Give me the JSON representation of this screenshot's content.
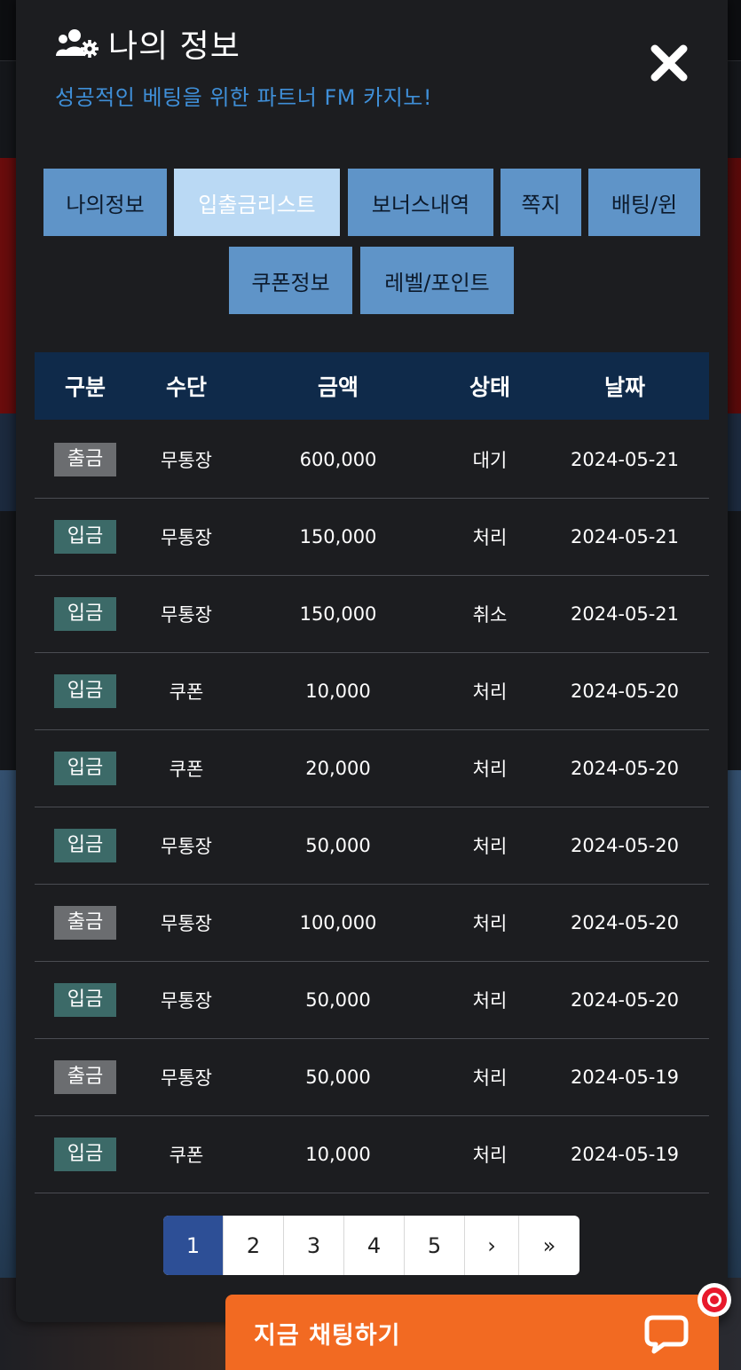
{
  "modal": {
    "title": "나의 정보",
    "subtitle": "성공적인 베팅을 위한 파트너 FM 카지노!"
  },
  "tabs": [
    {
      "label": "나의정보",
      "active": false
    },
    {
      "label": "입출금리스트",
      "active": true
    },
    {
      "label": "보너스내역",
      "active": false
    },
    {
      "label": "쪽지",
      "active": false
    },
    {
      "label": "배팅/윈",
      "active": false
    },
    {
      "label": "쿠폰정보",
      "active": false
    },
    {
      "label": "레벨/포인트",
      "active": false
    }
  ],
  "table": {
    "headers": [
      "구분",
      "수단",
      "금액",
      "상태",
      "날짜"
    ],
    "rows": [
      {
        "type": "출금",
        "kind": "out",
        "method": "무통장",
        "amount": "600,000",
        "status": "대기",
        "date": "2024-05-21"
      },
      {
        "type": "입금",
        "kind": "in",
        "method": "무통장",
        "amount": "150,000",
        "status": "처리",
        "date": "2024-05-21"
      },
      {
        "type": "입금",
        "kind": "in",
        "method": "무통장",
        "amount": "150,000",
        "status": "취소",
        "date": "2024-05-21"
      },
      {
        "type": "입금",
        "kind": "in",
        "method": "쿠폰",
        "amount": "10,000",
        "status": "처리",
        "date": "2024-05-20"
      },
      {
        "type": "입금",
        "kind": "in",
        "method": "쿠폰",
        "amount": "20,000",
        "status": "처리",
        "date": "2024-05-20"
      },
      {
        "type": "입금",
        "kind": "in",
        "method": "무통장",
        "amount": "50,000",
        "status": "처리",
        "date": "2024-05-20"
      },
      {
        "type": "출금",
        "kind": "out",
        "method": "무통장",
        "amount": "100,000",
        "status": "처리",
        "date": "2024-05-20"
      },
      {
        "type": "입금",
        "kind": "in",
        "method": "무통장",
        "amount": "50,000",
        "status": "처리",
        "date": "2024-05-20"
      },
      {
        "type": "출금",
        "kind": "out",
        "method": "무통장",
        "amount": "50,000",
        "status": "처리",
        "date": "2024-05-19"
      },
      {
        "type": "입금",
        "kind": "in",
        "method": "쿠폰",
        "amount": "10,000",
        "status": "처리",
        "date": "2024-05-19"
      }
    ]
  },
  "pagination": {
    "pages": [
      "1",
      "2",
      "3",
      "4",
      "5"
    ],
    "current": "1",
    "next": "›",
    "last": "»"
  },
  "chat": {
    "label": "지금 채팅하기"
  },
  "icons": {
    "title": "users-gear-icon",
    "close": "close-icon",
    "chat": "chat-bubble-icon",
    "badge": "notification-dot-icon"
  },
  "colors": {
    "accent": "#3f8fd8",
    "tab": "#5f94c8",
    "tab_active": "#bad9f4",
    "header": "#0f2a4a",
    "deposit_badge": "#3c6a68",
    "withdraw_badge": "#6b6d70",
    "page_active": "#2d4f96",
    "chat": "#f26a22"
  }
}
